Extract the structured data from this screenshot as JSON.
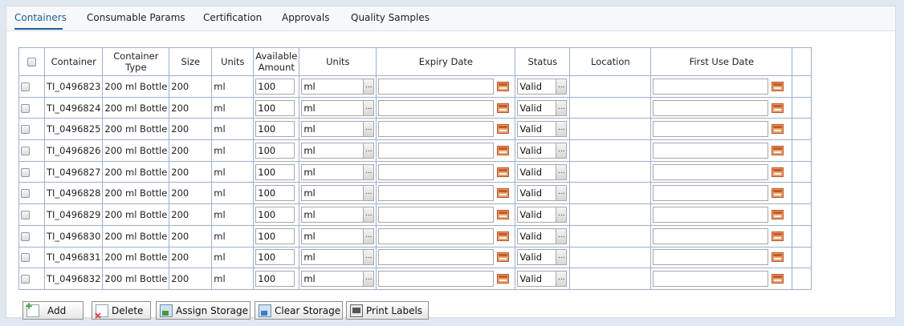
{
  "tabs": [
    {
      "label": "Containers",
      "active": true
    },
    {
      "label": "Consumable Params",
      "active": false
    },
    {
      "label": "Certification",
      "active": false
    },
    {
      "label": "Approvals",
      "active": false
    },
    {
      "label": "Quality Samples",
      "active": false
    }
  ],
  "table": {
    "headers": {
      "container": "Container",
      "container_type_1": "Container",
      "container_type_2": "Type",
      "size": "Size",
      "units": "Units",
      "available_amount_1": "Available",
      "available_amount_2": "Amount",
      "units_input": "Units",
      "expiry_date": "Expiry Date",
      "status": "Status",
      "location": "Location",
      "first_use_date": "First Use Date"
    },
    "rows": [
      {
        "container": "TI_0496823",
        "type": "200 ml Bottle",
        "size": "200",
        "units": "ml",
        "amount": "100",
        "units_value": "ml",
        "expiry": "",
        "status": "Valid",
        "location": "",
        "first_use": ""
      },
      {
        "container": "TI_0496824",
        "type": "200 ml Bottle",
        "size": "200",
        "units": "ml",
        "amount": "100",
        "units_value": "ml",
        "expiry": "",
        "status": "Valid",
        "location": "",
        "first_use": ""
      },
      {
        "container": "TI_0496825",
        "type": "200 ml Bottle",
        "size": "200",
        "units": "ml",
        "amount": "100",
        "units_value": "ml",
        "expiry": "",
        "status": "Valid",
        "location": "",
        "first_use": ""
      },
      {
        "container": "TI_0496826",
        "type": "200 ml Bottle",
        "size": "200",
        "units": "ml",
        "amount": "100",
        "units_value": "ml",
        "expiry": "",
        "status": "Valid",
        "location": "",
        "first_use": ""
      },
      {
        "container": "TI_0496827",
        "type": "200 ml Bottle",
        "size": "200",
        "units": "ml",
        "amount": "100",
        "units_value": "ml",
        "expiry": "",
        "status": "Valid",
        "location": "",
        "first_use": ""
      },
      {
        "container": "TI_0496828",
        "type": "200 ml Bottle",
        "size": "200",
        "units": "ml",
        "amount": "100",
        "units_value": "ml",
        "expiry": "",
        "status": "Valid",
        "location": "",
        "first_use": ""
      },
      {
        "container": "TI_0496829",
        "type": "200 ml Bottle",
        "size": "200",
        "units": "ml",
        "amount": "100",
        "units_value": "ml",
        "expiry": "",
        "status": "Valid",
        "location": "",
        "first_use": ""
      },
      {
        "container": "TI_0496830",
        "type": "200 ml Bottle",
        "size": "200",
        "units": "ml",
        "amount": "100",
        "units_value": "ml",
        "expiry": "",
        "status": "Valid",
        "location": "",
        "first_use": ""
      },
      {
        "container": "TI_0496831",
        "type": "200 ml Bottle",
        "size": "200",
        "units": "ml",
        "amount": "100",
        "units_value": "ml",
        "expiry": "",
        "status": "Valid",
        "location": "",
        "first_use": ""
      },
      {
        "container": "TI_0496832",
        "type": "200 ml Bottle",
        "size": "200",
        "units": "ml",
        "amount": "100",
        "units_value": "ml",
        "expiry": "",
        "status": "Valid",
        "location": "",
        "first_use": ""
      }
    ]
  },
  "buttons": {
    "add": {
      "label": "Add",
      "icon": "add-icon"
    },
    "delete": {
      "label": "Delete",
      "icon": "delete-icon"
    },
    "assign_storage": {
      "label": "Assign Storage",
      "icon": "assign-storage-icon"
    },
    "clear_storage": {
      "label": "Clear Storage",
      "icon": "clear-storage-icon"
    },
    "print_labels": {
      "label": "Print Labels",
      "icon": "printer-icon"
    }
  },
  "colors": {
    "active_tab": "#1e5f95",
    "grid_border": "#9ab2cf",
    "calendar_icon": "#c65a1f"
  }
}
